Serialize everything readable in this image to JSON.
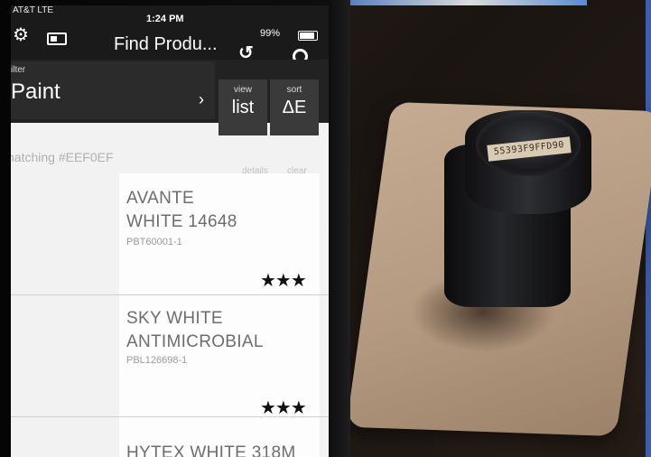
{
  "status": {
    "carrier": "AT&T LTE",
    "time": "1:24 PM",
    "battery": "99%"
  },
  "appbar": {
    "title": "Find Produ..."
  },
  "filter": {
    "label": "ilter",
    "value": "Paint",
    "view_label": "view",
    "view_value": "list",
    "sort_label": "sort",
    "sort_value": "ΔE"
  },
  "match": {
    "text": "natching #EEF0EF",
    "details": "details",
    "clear": "clear"
  },
  "products": [
    {
      "name_line1": "AVANTE",
      "name_line2": "WHITE 14648",
      "code": "PBT60001-1",
      "stars": "★★★"
    },
    {
      "name_line1": "SKY WHITE",
      "name_line2": "ANTIMICROBIAL",
      "code": "PBL126698-1",
      "stars": "★★★"
    },
    {
      "name_line1": "HYTEX WHITE 318M",
      "name_line2": "",
      "code": "",
      "stars": ""
    }
  ],
  "device": {
    "label": "55393F9FFD90"
  },
  "colors": {
    "match_hex": "#EEF0EF",
    "appbar": "#1a1a1a"
  }
}
